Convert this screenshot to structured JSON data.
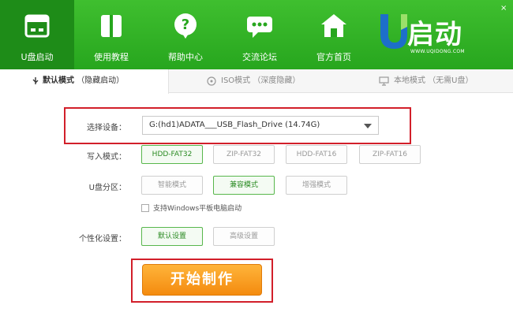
{
  "nav": {
    "items": [
      {
        "label": "U盘启动",
        "icon": "usb-drive-icon"
      },
      {
        "label": "使用教程",
        "icon": "book-icon"
      },
      {
        "label": "帮助中心",
        "icon": "help-icon"
      },
      {
        "label": "交流论坛",
        "icon": "chat-icon"
      },
      {
        "label": "官方首页",
        "icon": "home-icon"
      }
    ],
    "active_index": 0
  },
  "logo": {
    "text": "启动",
    "url": "WWW.UQIDONG.COM"
  },
  "window_buttons": {
    "close": "×"
  },
  "tabs": [
    {
      "label": "默认模式",
      "sub": "（隐藏启动）"
    },
    {
      "label": "ISO模式",
      "sub": "（深度隐藏）"
    },
    {
      "label": "本地模式",
      "sub": "（无需U盘）"
    }
  ],
  "device": {
    "label": "选择设备：",
    "value": "G:(hd1)ADATA___USB_Flash_Drive (14.74G)"
  },
  "write_mode": {
    "label": "写入模式：",
    "options": [
      "HDD-FAT32",
      "ZIP-FAT32",
      "HDD-FAT16",
      "ZIP-FAT16"
    ],
    "selected": "HDD-FAT32"
  },
  "partition": {
    "label": "U盘分区：",
    "options": [
      "智能模式",
      "兼容模式",
      "增强模式"
    ],
    "selected": "兼容模式"
  },
  "tablet_support": {
    "label": "支持Windows平板电脑启动",
    "checked": false
  },
  "personalize": {
    "label": "个性化设置：",
    "options": [
      "默认设置",
      "高级设置"
    ],
    "selected": "默认设置"
  },
  "start_button": {
    "label": "开始制作"
  },
  "colors": {
    "header_green": "#2fb024",
    "accent_orange": "#f48b0f",
    "highlight_red": "#d21f2a"
  }
}
